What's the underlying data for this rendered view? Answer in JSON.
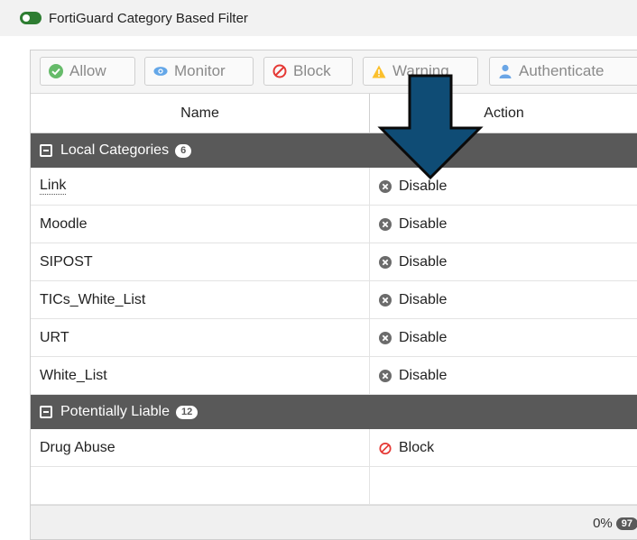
{
  "header": {
    "title": "FortiGuard Category Based Filter",
    "toggle_color": "#2e7d32"
  },
  "toolbar": {
    "buttons": [
      {
        "label": "Allow",
        "icon": "check-circle-icon",
        "color": "#4caf50"
      },
      {
        "label": "Monitor",
        "icon": "eye-icon",
        "color": "#2196f3"
      },
      {
        "label": "Block",
        "icon": "block-icon",
        "color": "#e53935"
      },
      {
        "label": "Warning",
        "icon": "warning-icon",
        "color": "#fbc02d"
      },
      {
        "label": "Authenticate",
        "icon": "user-icon",
        "color": "#5c9ce6"
      }
    ]
  },
  "table": {
    "columns": [
      "Name",
      "Action"
    ],
    "groups": [
      {
        "label": "Local Categories",
        "count": "6",
        "rows": [
          {
            "name": "Link",
            "action": "Disable",
            "action_icon": "disable-icon"
          },
          {
            "name": "Moodle",
            "action": "Disable",
            "action_icon": "disable-icon"
          },
          {
            "name": "SIPOST",
            "action": "Disable",
            "action_icon": "disable-icon"
          },
          {
            "name": "TICs_White_List",
            "action": "Disable",
            "action_icon": "disable-icon"
          },
          {
            "name": "URT",
            "action": "Disable",
            "action_icon": "disable-icon"
          },
          {
            "name": "White_List",
            "action": "Disable",
            "action_icon": "disable-icon"
          }
        ]
      },
      {
        "label": "Potentially Liable",
        "count": "12",
        "rows": [
          {
            "name": "Drug Abuse",
            "action": "Block",
            "action_icon": "block-icon"
          }
        ]
      }
    ]
  },
  "footer": {
    "percent": "0%",
    "badge": "97"
  },
  "overlay": {
    "icon": "down-arrow-icon",
    "color": "#0f4c75"
  }
}
